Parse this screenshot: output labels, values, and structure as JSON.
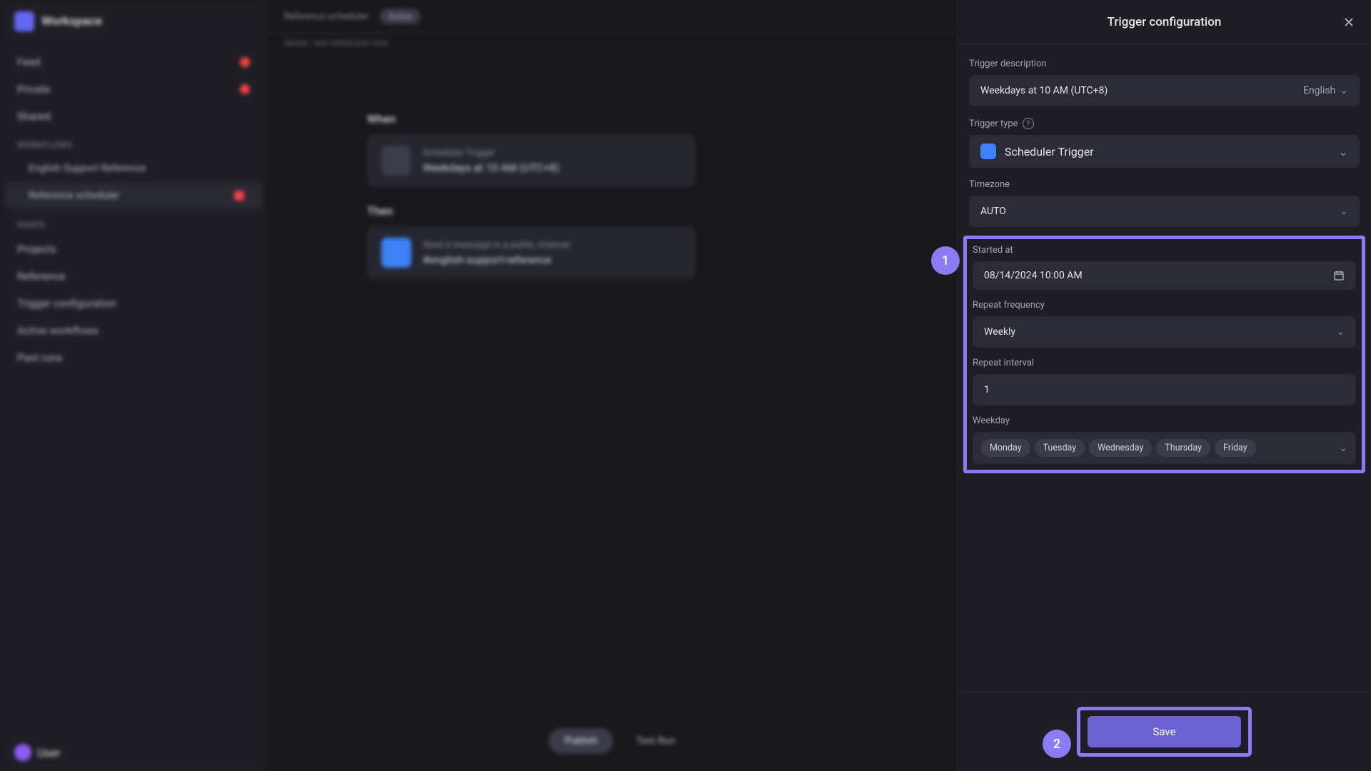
{
  "workspace": {
    "name": "Workspace"
  },
  "sidebar": {
    "top": [
      {
        "label": "Feed"
      },
      {
        "label": "Private"
      },
      {
        "label": "Shared"
      }
    ],
    "workflows_label": "WORKFLOWS",
    "wf_group": "English Support Reference",
    "wf_active": "Reference scheduler",
    "pages_label": "PAGES",
    "pages": [
      {
        "label": "Projects"
      },
      {
        "label": "Reference"
      },
      {
        "label": "Trigger configuration"
      },
      {
        "label": "Active workflows"
      },
      {
        "label": "Past runs"
      }
    ],
    "footer_user": "User"
  },
  "main": {
    "breadcrumb": "Reference scheduler",
    "pill": "Active",
    "saved": "Saved · last edited just now",
    "when_label": "When",
    "when_title": "Scheduler Trigger",
    "when_sub": "Weekdays at 10 AM (UTC+8)",
    "then_label": "Then",
    "then_title": "Send a message in a public channel",
    "then_sub": "#english-support-reference",
    "publish": "Publish",
    "test": "Test Run"
  },
  "panel": {
    "title": "Trigger configuration",
    "desc_label": "Trigger description",
    "desc_value": "Weekdays at 10 AM (UTC+8)",
    "lang": "English",
    "type_label": "Trigger type",
    "type_value": "Scheduler Trigger",
    "tz_label": "Timezone",
    "tz_value": "AUTO",
    "started_label": "Started at",
    "started_value": "08/14/2024 10:00 AM",
    "freq_label": "Repeat frequency",
    "freq_value": "Weekly",
    "interval_label": "Repeat interval",
    "interval_value": "1",
    "weekday_label": "Weekday",
    "weekdays": [
      "Monday",
      "Tuesday",
      "Wednesday",
      "Thursday",
      "Friday"
    ],
    "save": "Save"
  },
  "callouts": {
    "one": "1",
    "two": "2"
  }
}
